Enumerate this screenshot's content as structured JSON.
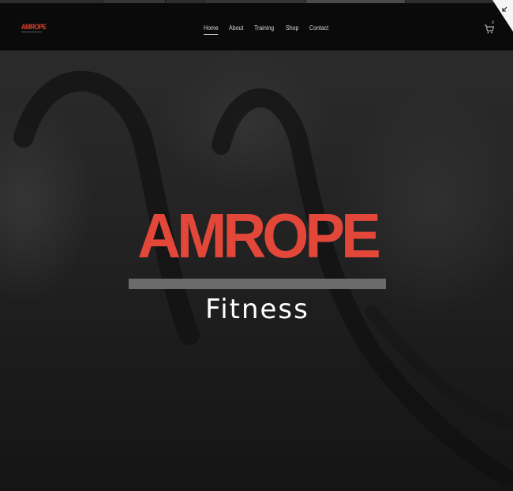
{
  "site": {
    "logo_text": "AMROPE",
    "cart_count": "0"
  },
  "nav": {
    "items": [
      {
        "label": "Home",
        "active": true
      },
      {
        "label": "About",
        "active": false
      },
      {
        "label": "Training",
        "active": false
      },
      {
        "label": "Shop",
        "active": false
      },
      {
        "label": "Contact",
        "active": false
      }
    ]
  },
  "hero": {
    "brand_name": "AMROPE",
    "tagline": "Fitness"
  },
  "colors": {
    "brand_red": "#e2473a",
    "nav_bg": "#0a0a0a",
    "bar_gray": "#6b6b6b",
    "text_white": "#ffffff"
  },
  "icons": {
    "cart": "cart-icon",
    "corner": "collapse-arrow-icon"
  }
}
